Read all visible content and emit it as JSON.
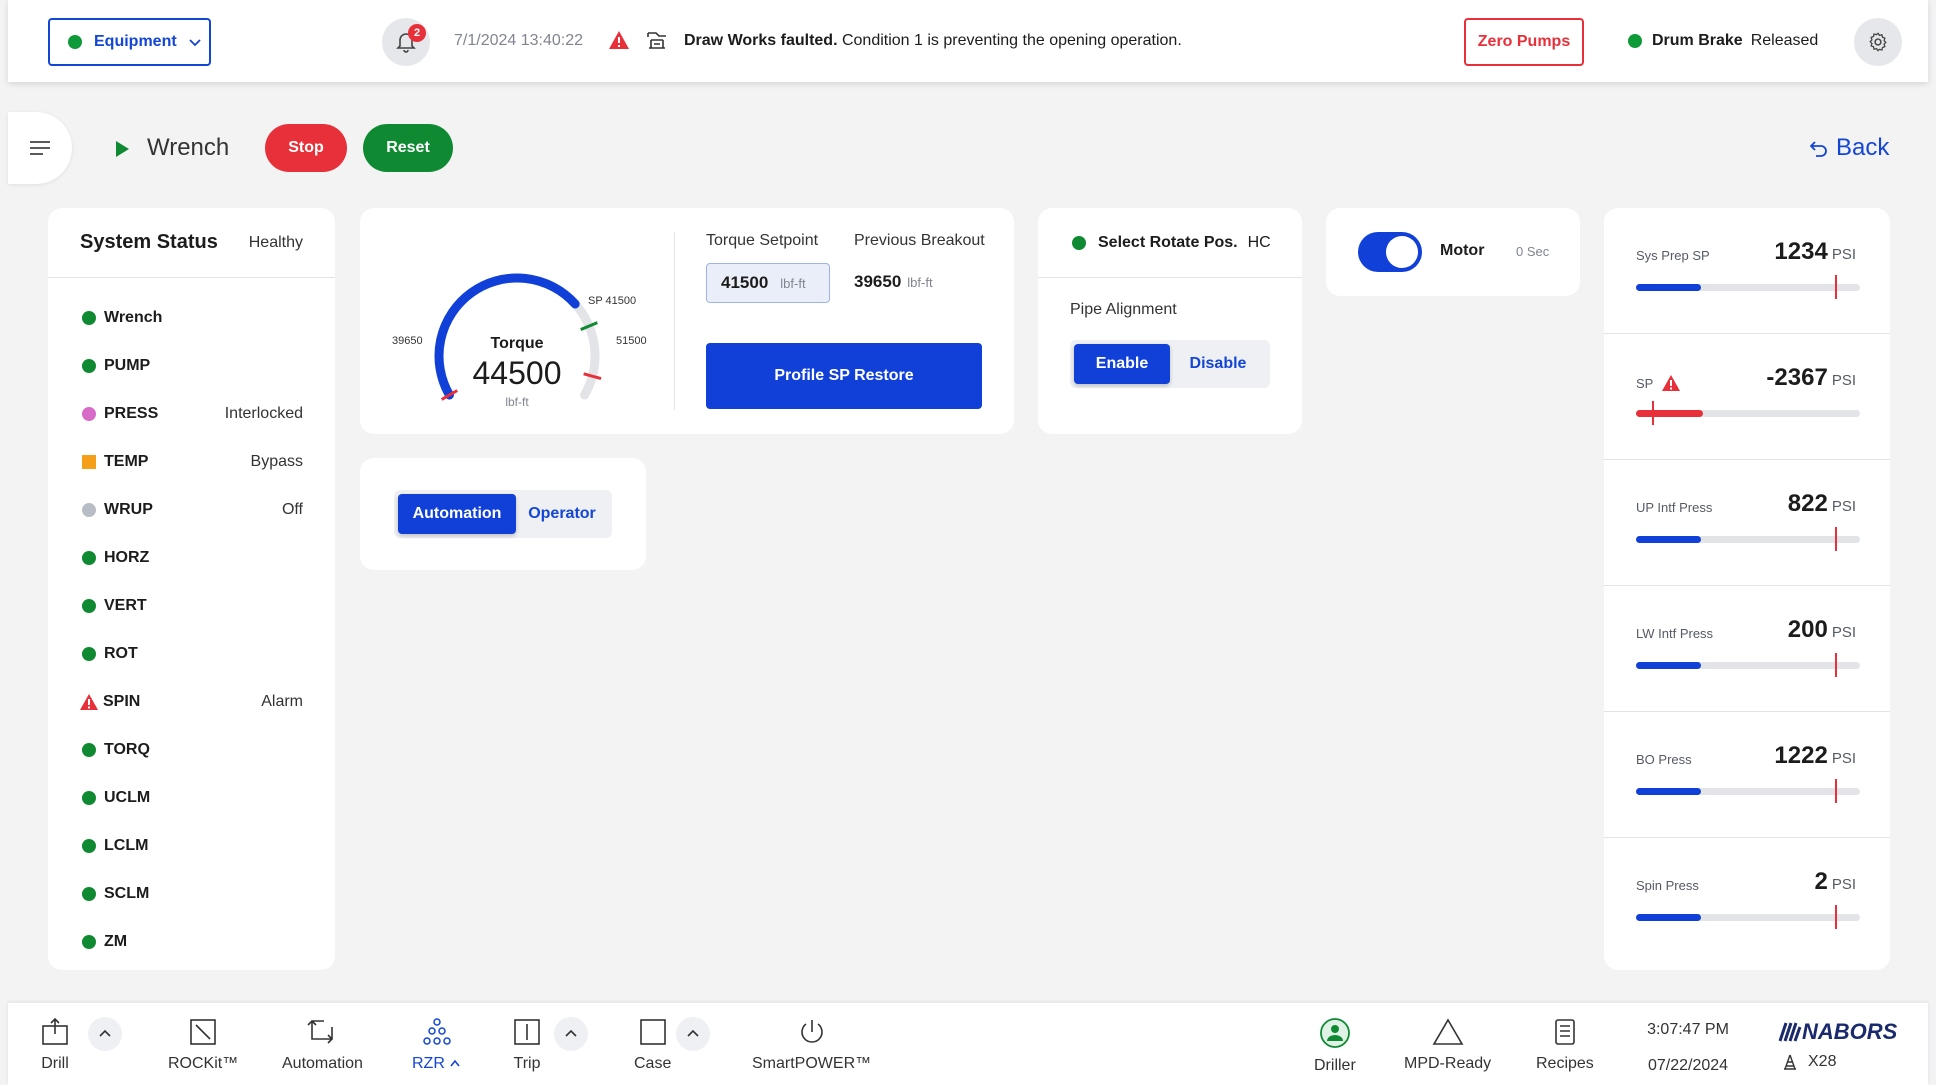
{
  "topbar": {
    "equipment_label": "Equipment",
    "notification_count": "2",
    "datetime": "7/1/2024  13:40:22",
    "fault_bold": "Draw Works faulted.",
    "fault_text": " Condition 1 is preventing the opening operation.",
    "zero_pumps_label": "Zero Pumps",
    "drum_label": "Drum Brake",
    "drum_state": "Released"
  },
  "header": {
    "mode_title": "Wrench",
    "stop_label": "Stop",
    "reset_label": "Reset",
    "back_label": "Back"
  },
  "system_status": {
    "title": "System Status",
    "state": "Healthy",
    "items": [
      {
        "name": "Wrench",
        "value": "",
        "indicator": "green"
      },
      {
        "name": "PUMP",
        "value": "",
        "indicator": "green"
      },
      {
        "name": "PRESS",
        "value": "Interlocked",
        "indicator": "pink"
      },
      {
        "name": "TEMP",
        "value": "Bypass",
        "indicator": "orange"
      },
      {
        "name": "WRUP",
        "value": "Off",
        "indicator": "gray"
      },
      {
        "name": "HORZ",
        "value": "",
        "indicator": "green"
      },
      {
        "name": "VERT",
        "value": "",
        "indicator": "green"
      },
      {
        "name": "ROT",
        "value": "",
        "indicator": "green"
      },
      {
        "name": "SPIN",
        "value": "Alarm",
        "indicator": "alarm"
      },
      {
        "name": "TORQ",
        "value": "",
        "indicator": "green"
      },
      {
        "name": "UCLM",
        "value": "",
        "indicator": "green"
      },
      {
        "name": "LCLM",
        "value": "",
        "indicator": "green"
      },
      {
        "name": "SCLM",
        "value": "",
        "indicator": "green"
      },
      {
        "name": "ZM",
        "value": "",
        "indicator": "green"
      }
    ]
  },
  "torque": {
    "gauge_label": "Torque",
    "value": "44500",
    "unit": "lbf-ft",
    "min_label": "39650",
    "max_label": "51500",
    "sp_label": "SP 41500",
    "gauge_min": 39650,
    "gauge_max": 51500,
    "gauge_value": 44500,
    "gauge_sp": 41500,
    "setpoint_title": "Torque Setpoint",
    "setpoint_value": "41500",
    "setpoint_unit": "lbf-ft",
    "prev_title": "Previous Breakout",
    "prev_value": "39650",
    "prev_unit": "lbf-ft",
    "restore_label": "Profile SP Restore"
  },
  "rotate": {
    "title": "Select Rotate Pos.",
    "value": "HC",
    "pipe_label": "Pipe Alignment",
    "enable_label": "Enable",
    "disable_label": "Disable"
  },
  "motor": {
    "label": "Motor",
    "time": "0 Sec"
  },
  "control_mode": {
    "automation_label": "Automation",
    "operator_label": "Operator"
  },
  "pressures": [
    {
      "name": "Sys Prep SP",
      "value": "1234",
      "unit": "PSI",
      "fill": 0.29,
      "color": "#1040d8",
      "mark": 0.89,
      "alarm": false
    },
    {
      "name": "SP",
      "value": "-2367",
      "unit": "PSI",
      "fill": 0.3,
      "color": "#e8303a",
      "mark": 0.07,
      "alarm": true
    },
    {
      "name": "UP Intf Press",
      "value": "822",
      "unit": "PSI",
      "fill": 0.29,
      "color": "#1040d8",
      "mark": 0.89,
      "alarm": false
    },
    {
      "name": "LW Intf Press",
      "value": "200",
      "unit": "PSI",
      "fill": 0.29,
      "color": "#1040d8",
      "mark": 0.89,
      "alarm": false
    },
    {
      "name": "BO Press",
      "value": "1222",
      "unit": "PSI",
      "fill": 0.29,
      "color": "#1040d8",
      "mark": 0.89,
      "alarm": false
    },
    {
      "name": "Spin Press",
      "value": "2",
      "unit": "PSI",
      "fill": 0.29,
      "color": "#1040d8",
      "mark": 0.89,
      "alarm": false
    }
  ],
  "bottom_nav": {
    "drill": "Drill",
    "rockit": "ROCKit™",
    "automation": "Automation",
    "rzr": "RZR",
    "trip": "Trip",
    "case": "Case",
    "smartpower": "SmartPOWER™",
    "driller": "Driller",
    "mpd": "MPD-Ready",
    "recipes": "Recipes",
    "time": "3:07:47 PM",
    "date": "07/22/2024",
    "brand": "NABORS",
    "rig": "X28"
  }
}
